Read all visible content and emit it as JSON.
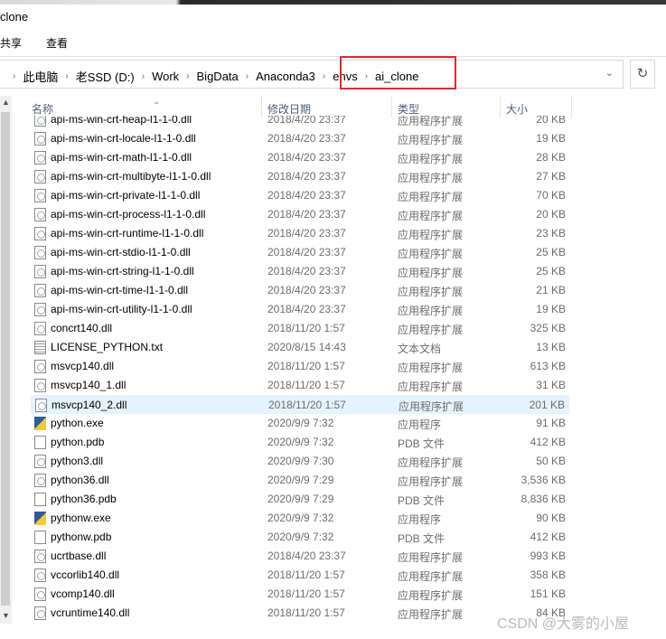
{
  "window": {
    "title": "clone"
  },
  "menu": {
    "share": "共享",
    "view": "查看"
  },
  "address": {
    "crumbs": [
      "此电脑",
      "老SSD (D:)",
      "Work",
      "BigData",
      "Anaconda3",
      "envs",
      "ai_clone"
    ]
  },
  "columns": {
    "name": "名称",
    "date": "修改日期",
    "type": "类型",
    "size": "大小"
  },
  "files": [
    {
      "name": "api-ms-win-crt-heap-l1-1-0.dll",
      "date": "2018/4/20 23:37",
      "type": "应用程序扩展",
      "size": "20 KB",
      "icon": "dll"
    },
    {
      "name": "api-ms-win-crt-locale-l1-1-0.dll",
      "date": "2018/4/20 23:37",
      "type": "应用程序扩展",
      "size": "19 KB",
      "icon": "dll"
    },
    {
      "name": "api-ms-win-crt-math-l1-1-0.dll",
      "date": "2018/4/20 23:37",
      "type": "应用程序扩展",
      "size": "28 KB",
      "icon": "dll"
    },
    {
      "name": "api-ms-win-crt-multibyte-l1-1-0.dll",
      "date": "2018/4/20 23:37",
      "type": "应用程序扩展",
      "size": "27 KB",
      "icon": "dll"
    },
    {
      "name": "api-ms-win-crt-private-l1-1-0.dll",
      "date": "2018/4/20 23:37",
      "type": "应用程序扩展",
      "size": "70 KB",
      "icon": "dll"
    },
    {
      "name": "api-ms-win-crt-process-l1-1-0.dll",
      "date": "2018/4/20 23:37",
      "type": "应用程序扩展",
      "size": "20 KB",
      "icon": "dll"
    },
    {
      "name": "api-ms-win-crt-runtime-l1-1-0.dll",
      "date": "2018/4/20 23:37",
      "type": "应用程序扩展",
      "size": "23 KB",
      "icon": "dll"
    },
    {
      "name": "api-ms-win-crt-stdio-l1-1-0.dll",
      "date": "2018/4/20 23:37",
      "type": "应用程序扩展",
      "size": "25 KB",
      "icon": "dll"
    },
    {
      "name": "api-ms-win-crt-string-l1-1-0.dll",
      "date": "2018/4/20 23:37",
      "type": "应用程序扩展",
      "size": "25 KB",
      "icon": "dll"
    },
    {
      "name": "api-ms-win-crt-time-l1-1-0.dll",
      "date": "2018/4/20 23:37",
      "type": "应用程序扩展",
      "size": "21 KB",
      "icon": "dll"
    },
    {
      "name": "api-ms-win-crt-utility-l1-1-0.dll",
      "date": "2018/4/20 23:37",
      "type": "应用程序扩展",
      "size": "19 KB",
      "icon": "dll"
    },
    {
      "name": "concrt140.dll",
      "date": "2018/11/20 1:57",
      "type": "应用程序扩展",
      "size": "325 KB",
      "icon": "dll"
    },
    {
      "name": "LICENSE_PYTHON.txt",
      "date": "2020/8/15 14:43",
      "type": "文本文档",
      "size": "13 KB",
      "icon": "txt"
    },
    {
      "name": "msvcp140.dll",
      "date": "2018/11/20 1:57",
      "type": "应用程序扩展",
      "size": "613 KB",
      "icon": "dll"
    },
    {
      "name": "msvcp140_1.dll",
      "date": "2018/11/20 1:57",
      "type": "应用程序扩展",
      "size": "31 KB",
      "icon": "dll"
    },
    {
      "name": "msvcp140_2.dll",
      "date": "2018/11/20 1:57",
      "type": "应用程序扩展",
      "size": "201 KB",
      "icon": "dll",
      "selected": true
    },
    {
      "name": "python.exe",
      "date": "2020/9/9 7:32",
      "type": "应用程序",
      "size": "91 KB",
      "icon": "exe"
    },
    {
      "name": "python.pdb",
      "date": "2020/9/9 7:32",
      "type": "PDB 文件",
      "size": "412 KB",
      "icon": "file"
    },
    {
      "name": "python3.dll",
      "date": "2020/9/9 7:30",
      "type": "应用程序扩展",
      "size": "50 KB",
      "icon": "dll"
    },
    {
      "name": "python36.dll",
      "date": "2020/9/9 7:29",
      "type": "应用程序扩展",
      "size": "3,536 KB",
      "icon": "dll"
    },
    {
      "name": "python36.pdb",
      "date": "2020/9/9 7:29",
      "type": "PDB 文件",
      "size": "8,836 KB",
      "icon": "file"
    },
    {
      "name": "pythonw.exe",
      "date": "2020/9/9 7:32",
      "type": "应用程序",
      "size": "90 KB",
      "icon": "exe"
    },
    {
      "name": "pythonw.pdb",
      "date": "2020/9/9 7:32",
      "type": "PDB 文件",
      "size": "412 KB",
      "icon": "file"
    },
    {
      "name": "ucrtbase.dll",
      "date": "2018/4/20 23:37",
      "type": "应用程序扩展",
      "size": "993 KB",
      "icon": "dll"
    },
    {
      "name": "vccorlib140.dll",
      "date": "2018/11/20 1:57",
      "type": "应用程序扩展",
      "size": "358 KB",
      "icon": "dll"
    },
    {
      "name": "vcomp140.dll",
      "date": "2018/11/20 1:57",
      "type": "应用程序扩展",
      "size": "151 KB",
      "icon": "dll"
    },
    {
      "name": "vcruntime140.dll",
      "date": "2018/11/20 1:57",
      "type": "应用程序扩展",
      "size": "84 KB",
      "icon": "dll"
    }
  ],
  "watermark": "CSDN @大雾的小屋",
  "colors": {
    "highlight_box": "#e8262b",
    "selected_row": "#e5f3ff"
  }
}
